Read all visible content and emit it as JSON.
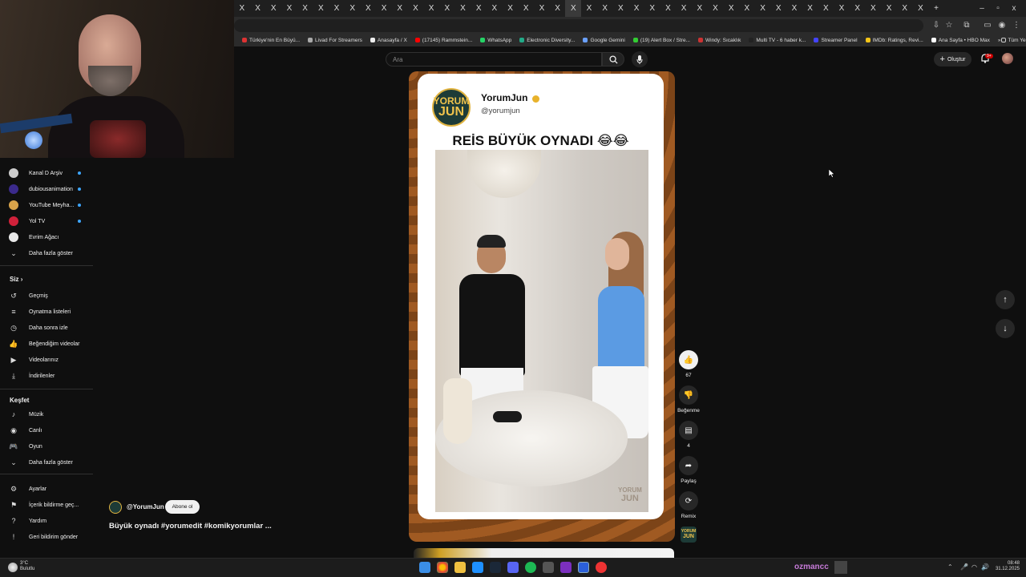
{
  "browser": {
    "tab_close_glyph": "X",
    "new_tab_glyph": "+",
    "window_controls": [
      "–",
      "▫",
      "x"
    ],
    "bookmarks": [
      {
        "label": "Türkiye'nin En Büyü...",
        "color": "#d33"
      },
      {
        "label": "Livad For Streamers",
        "color": "#aaa"
      },
      {
        "label": "Anasayfa / X",
        "color": "#eee"
      },
      {
        "label": "(17145) Rammstein...",
        "color": "#f00"
      },
      {
        "label": "WhatsApp",
        "color": "#25d366"
      },
      {
        "label": "Electronic Diversity...",
        "color": "#2a8"
      },
      {
        "label": "Google Gemini",
        "color": "#6aa0ff"
      },
      {
        "label": "(19) Alert Box / Stre...",
        "color": "#3c3"
      },
      {
        "label": "Windy: Sıcaklık",
        "color": "#c33"
      },
      {
        "label": "Multi TV - 6 haber k...",
        "color": "#222"
      },
      {
        "label": "Streamer Panel",
        "color": "#44f"
      },
      {
        "label": "IMDb: Ratings, Revi...",
        "color": "#f5c518"
      },
      {
        "label": "Ana Sayfa • HBO Max",
        "color": "#fff"
      }
    ],
    "bookmarks_more": "»",
    "all_bookmarks": "Tüm Yer İşaretleri"
  },
  "header": {
    "search_placeholder": "Ara",
    "create_label": "Oluştur",
    "notif_count": "9+"
  },
  "sidebar": {
    "subscriptions": [
      {
        "label": "Kanal D Arşiv",
        "color": "#ccc"
      },
      {
        "label": "dubiousanimation",
        "color": "#3b2a8c"
      },
      {
        "label": "YouTube Meyha...",
        "color": "#d9a34a"
      },
      {
        "label": "Yol TV",
        "color": "#d0213a"
      },
      {
        "label": "Evrim Ağacı",
        "color": "#e9e9e9"
      }
    ],
    "show_more_1": "Daha fazla göster",
    "you_heading": "Siz",
    "you_items": [
      {
        "label": "Geçmiş",
        "icon": "↺"
      },
      {
        "label": "Oynatma listeleri",
        "icon": "≡"
      },
      {
        "label": "Daha sonra izle",
        "icon": "◷"
      },
      {
        "label": "Beğendiğim videolar",
        "icon": "👍"
      },
      {
        "label": "Videolarınız",
        "icon": "▶"
      },
      {
        "label": "İndirilenler",
        "icon": "⤓"
      }
    ],
    "explore_heading": "Keşfet",
    "explore_items": [
      {
        "label": "Müzik",
        "icon": "♪"
      },
      {
        "label": "Canlı",
        "icon": "◉"
      },
      {
        "label": "Oyun",
        "icon": "🎮"
      }
    ],
    "show_more_2": "Daha fazla göster",
    "footer_items": [
      {
        "label": "Ayarlar",
        "icon": "⚙"
      },
      {
        "label": "İçerik bildirme geç...",
        "icon": "⚑"
      },
      {
        "label": "Yardım",
        "icon": "?"
      },
      {
        "label": "Geri bildirim gönder",
        "icon": "!"
      }
    ]
  },
  "short": {
    "card_avatar_top": "YORUM",
    "card_avatar_bottom": "JUN",
    "card_name": "YorumJun",
    "card_handle": "@yorumjun",
    "card_caption": "REİS BÜYÜK OYNADI 😂😂",
    "watermark_top": "YORUM",
    "watermark_bottom": "JUN",
    "channel": "@YorumJun",
    "subscribe": "Abone ol",
    "title": "Büyük oynadı #yorumedit #komikyorumlar ...",
    "like_count": "67",
    "dislike_label": "Beğenme",
    "comment_count": "4",
    "share_label": "Paylaş",
    "remix_label": "Remix",
    "sound_top": "YORUM",
    "sound_bottom": "JUN"
  },
  "taskbar": {
    "temp": "3°C",
    "condition": "Bulutlu",
    "username": "ozmancc",
    "time": "08:48",
    "date": "31.12.2025"
  }
}
